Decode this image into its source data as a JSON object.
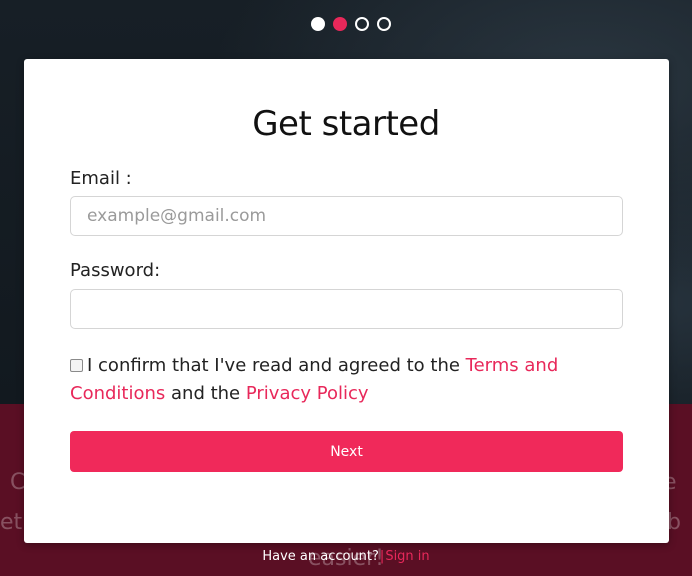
{
  "carousel": {
    "dots": [
      "filled-white",
      "filled-red",
      "hollow",
      "hollow"
    ],
    "active_index": 1
  },
  "colors": {
    "accent": "#f0295a",
    "link": "#e8285a",
    "bottom_band": "#5a0f24"
  },
  "background_text": {
    "left_1": "C",
    "left_2": "et",
    "right_1": "e",
    "right_2": "b",
    "center": "easier!"
  },
  "form": {
    "title": "Get started",
    "email_label": "Email :",
    "email_placeholder": "example@gmail.com",
    "email_value": "",
    "password_label": "Password:",
    "password_value": "",
    "confirm_text_1": "I confirm that I've read and agreed to the ",
    "terms_link": "Terms and Conditions",
    "confirm_text_2": " and the ",
    "privacy_link": "Privacy Policy",
    "checkbox_checked": false,
    "next_button": "Next"
  },
  "footer": {
    "prompt": "Have an account?",
    "separator": "|",
    "signin_link": "Sign in"
  }
}
